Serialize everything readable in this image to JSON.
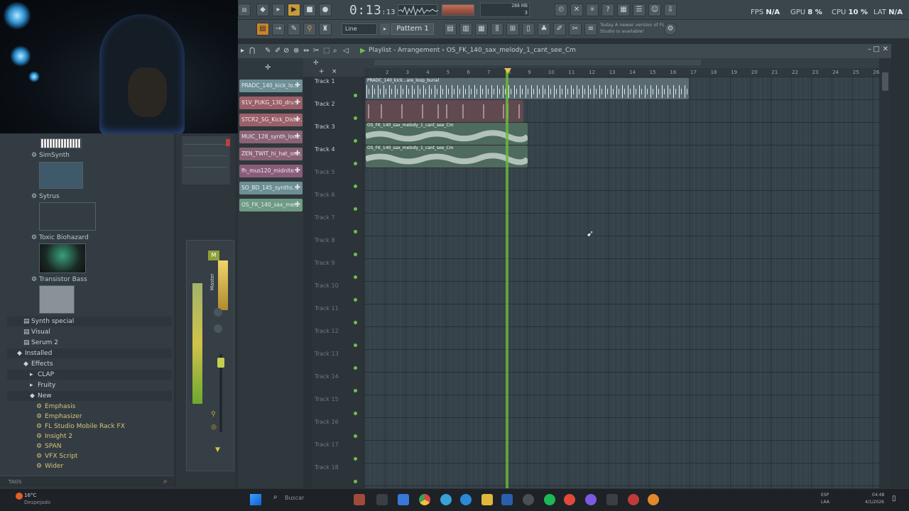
{
  "topbar": {
    "time": "0:13",
    "time_small": "13",
    "mem": "288 MB",
    "mem_num": "3",
    "fps_label": "FPS",
    "fps_value": "N/A",
    "gpu_label": "GPU",
    "gpu_value": "8 %",
    "cpu_label": "CPU",
    "cpu_value": "10 %",
    "lat_label": "LAT",
    "lat_value": "N/A",
    "snap_mode": "Line",
    "pattern": "Pattern 1",
    "news_date": "Today",
    "news_text": "A newer version of FL Studio is available!"
  },
  "playlist": {
    "title": "Playlist - Arrangement",
    "arrangement": "OS_FK_140_sax_melody_1_cant_see_Cm",
    "ruler": [
      "2",
      "3",
      "4",
      "5",
      "6",
      "7",
      "8",
      "9",
      "10",
      "11",
      "12",
      "13",
      "14",
      "15",
      "16",
      "17",
      "18",
      "19",
      "20",
      "21",
      "22",
      "23",
      "24",
      "25",
      "26"
    ],
    "tracks": [
      "Track 1",
      "Track 2",
      "Track 3",
      "Track 4",
      "Track 5",
      "Track 6",
      "Track 7",
      "Track 8",
      "Track 9",
      "Track 10",
      "Track 11",
      "Track 12",
      "Track 13",
      "Track 14",
      "Track 15",
      "Track 16",
      "Track 17",
      "Track 18"
    ],
    "clip_kick": "PRADC_140_kick...are_loop_burial",
    "clip_melody": "OS_FK_140_sax_melody_1_cant_see_Cm"
  },
  "channels": [
    {
      "label": "PRADC_140_kick_lo...",
      "color": "#6f8f96"
    },
    {
      "label": "91V_PUKG_130_dru...",
      "color": "#9b5f68"
    },
    {
      "label": "STCR2_SG_Kick_Dista...",
      "color": "#9b5f68"
    },
    {
      "label": "MUIC_128_synth_loo...",
      "color": "#8b6276"
    },
    {
      "label": "ZEN_TWIT_hi_hat_on...",
      "color": "#8b6276"
    },
    {
      "label": "fh_mus120_midnite...",
      "color": "#8b5c7a"
    },
    {
      "label": "SO_BD_145_synths...",
      "color": "#6d8f94"
    },
    {
      "label": "OS_FK_140_sax_mel...",
      "color": "#6f9a84"
    }
  ],
  "browser": {
    "plugins": [
      "SimSynth",
      "Sytrus",
      "Toxic Biohazard",
      "Transistor Bass"
    ],
    "folders": [
      "Synth special",
      "Visual",
      "Serum 2",
      "Installed",
      "Effects",
      "CLAP",
      "Fruity",
      "New"
    ],
    "new_items": [
      "Emphasis",
      "Emphasizer",
      "FL Studio Mobile Rack FX",
      "Insight 2",
      "SPAN",
      "VFX Script",
      "Wider"
    ],
    "tags_label": "TAGS"
  },
  "mixer": {
    "master_label": "Master",
    "m_label": "M"
  },
  "taskbar": {
    "weather_temp": "16°C",
    "weather_desc": "Despejado",
    "search_placeholder": "Buscar",
    "lang": "ESP",
    "lang2": "LAA",
    "clock_time": "04:48",
    "clock_date": "4/1/2026"
  }
}
